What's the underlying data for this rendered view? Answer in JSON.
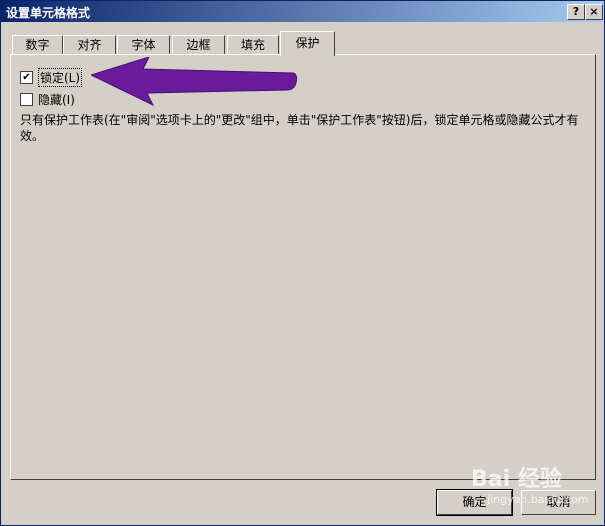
{
  "window": {
    "title": "设置单元格格式",
    "help_label": "?",
    "close_label": "×"
  },
  "tabs": [
    {
      "label": "数字"
    },
    {
      "label": "对齐"
    },
    {
      "label": "字体"
    },
    {
      "label": "边框"
    },
    {
      "label": "填充"
    },
    {
      "label": "保护"
    }
  ],
  "active_tab": "保护",
  "protection": {
    "locked": {
      "label": "锁定(L)",
      "checked": true
    },
    "hidden": {
      "label": "隐藏(I)",
      "checked": false
    },
    "description": "只有保护工作表(在\"审阅\"选项卡上的\"更改\"组中，单击\"保护工作表\"按钮)后，锁定单元格或隐藏公式才有效。"
  },
  "buttons": {
    "ok": "确定",
    "cancel": "取消"
  },
  "watermark": {
    "main": "Bai 经验",
    "sub": "jingyan.baidu.com"
  },
  "colors": {
    "arrow": "#6a1b9a",
    "titlebar_start": "#0a246a",
    "titlebar_end": "#a6caf0",
    "face": "#d4d0c8"
  }
}
